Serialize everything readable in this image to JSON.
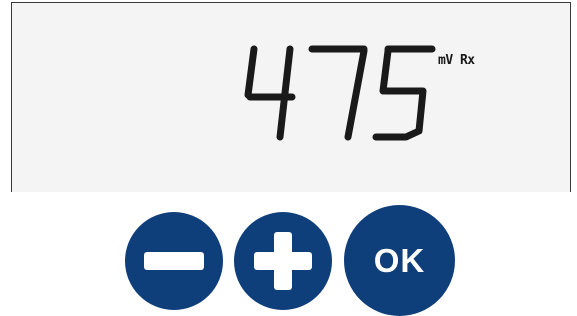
{
  "display": {
    "reading": "475",
    "unit": "mV Rx"
  },
  "keys": {
    "minus": {
      "icon": "minus-icon"
    },
    "plus": {
      "icon": "plus-icon"
    },
    "ok": {
      "label": "OK"
    }
  },
  "colors": {
    "key_blue": "#0f3f7a",
    "lcd_background": "#f4f4f4",
    "lcd_text": "#1a1a1a"
  }
}
